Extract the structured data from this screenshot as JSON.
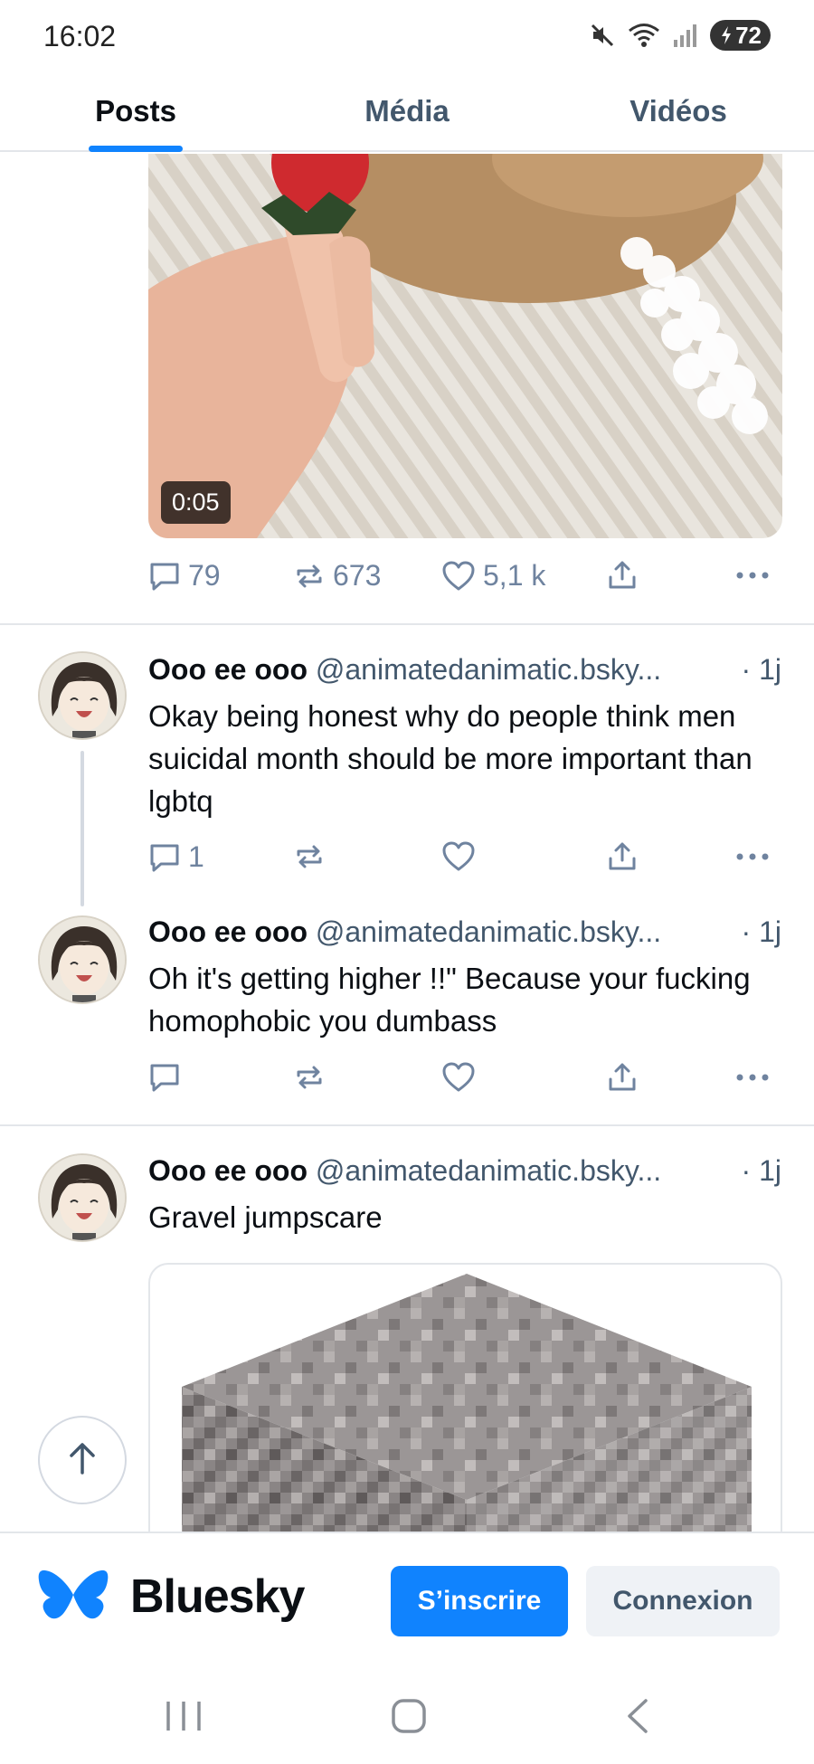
{
  "status_bar": {
    "time": "16:02",
    "battery": "72",
    "icons": [
      "mute-icon",
      "wifi-icon",
      "signal-icon",
      "battery-icon"
    ]
  },
  "tabs": [
    {
      "label": "Posts",
      "active": true
    },
    {
      "label": "Média",
      "active": false
    },
    {
      "label": "Vidéos",
      "active": false
    }
  ],
  "video_post": {
    "duration": "0:05",
    "replies": "79",
    "reposts": "673",
    "likes": "5,1 k"
  },
  "posts": [
    {
      "name": "Ooo ee ooo",
      "handle": "@animatedanimatic.bsky...",
      "time": "· 1j",
      "text": "Okay being honest why do people think men suicidal month should be more important than lgbtq",
      "replies": "1"
    },
    {
      "name": "Ooo ee ooo",
      "handle": "@animatedanimatic.bsky...",
      "time": "· 1j",
      "text": "Oh it's getting higher !!\" Because your fucking homophobic you dumbass"
    },
    {
      "name": "Ooo ee ooo",
      "handle": "@animatedanimatic.bsky...",
      "time": "· 1j",
      "text": "Gravel jumpscare"
    }
  ],
  "bottom_bar": {
    "brand": "Bluesky",
    "signup_label": "S’inscrire",
    "login_label": "Connexion",
    "brand_color": "#1083fe"
  }
}
